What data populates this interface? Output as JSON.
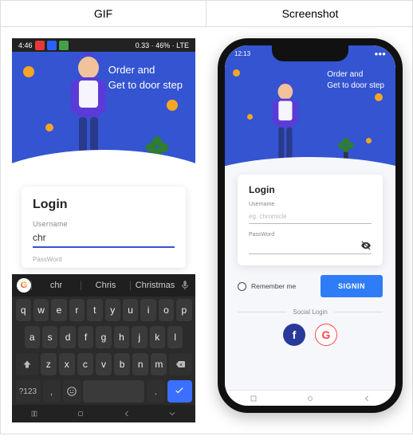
{
  "columns": {
    "left": "GIF",
    "right": "Screenshot"
  },
  "hero": {
    "line1": "Order and",
    "line2": "Get to door step"
  },
  "left": {
    "status": {
      "time": "4:46",
      "right": "0.33 · 46% · LTE"
    },
    "login": {
      "title": "Login",
      "username_label": "Username",
      "username_value": "chr",
      "password_label": "PassWord"
    },
    "suggestions": [
      "chr",
      "Chris",
      "Christmas"
    ],
    "keys_r1": [
      "q",
      "w",
      "e",
      "r",
      "t",
      "y",
      "u",
      "i",
      "o",
      "p"
    ],
    "keys_r2": [
      "a",
      "s",
      "d",
      "f",
      "g",
      "h",
      "j",
      "k",
      "l"
    ],
    "keys_r3": [
      "z",
      "x",
      "c",
      "v",
      "b",
      "n",
      "m"
    ],
    "sym": "?123",
    "comma": ",",
    "period": "."
  },
  "right": {
    "status": {
      "time": "12:13"
    },
    "login": {
      "title": "Login",
      "username_label": "Username",
      "username_placeholder": "eg. chromicle",
      "password_label": "PassWord"
    },
    "remember": "Remember me",
    "signin": "SIGNIN",
    "social_label": "Social Login",
    "fb": "f",
    "google": "G"
  }
}
